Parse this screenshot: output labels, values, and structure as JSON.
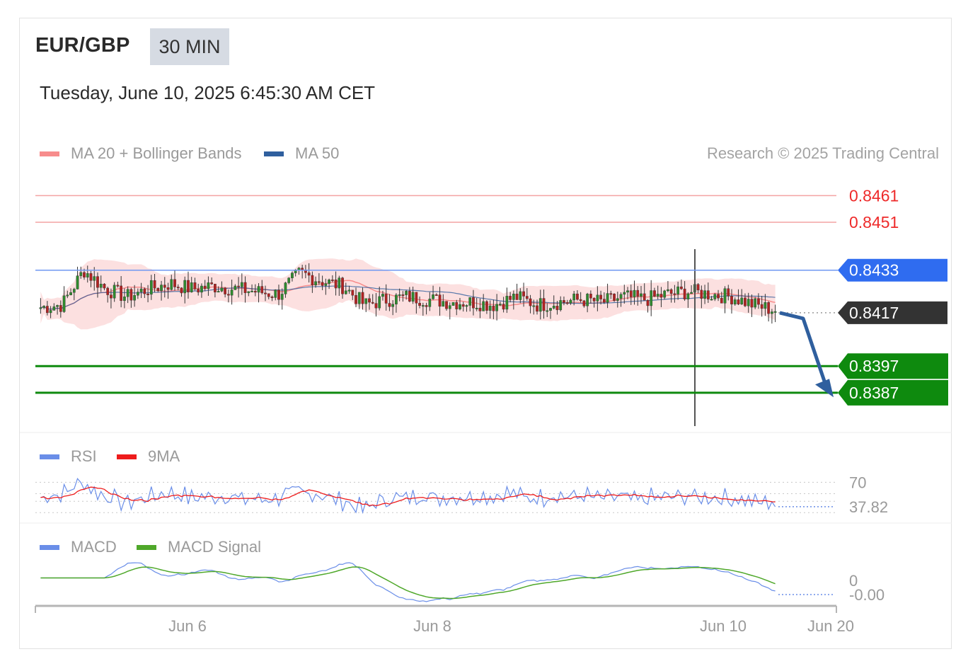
{
  "header": {
    "pair": "EUR/GBP",
    "timeframe": "30 MIN",
    "datetime": "Tuesday, June 10, 2025 6:45:30 AM CET"
  },
  "legend_main": {
    "ma20": "MA 20 + Bollinger Bands",
    "ma50": "MA 50",
    "ma20_color": "#f78c8c",
    "ma50_color": "#2f5f9e"
  },
  "credit": "Research © 2025 Trading Central",
  "legend_rsi": {
    "rsi": "RSI",
    "ma": "9MA",
    "rsi_color": "#6a8ee8",
    "ma_color": "#ee1c1c"
  },
  "legend_macd": {
    "macd": "MACD",
    "signal": "MACD Signal",
    "macd_color": "#6a8ee8",
    "signal_color": "#4fa82a"
  },
  "levels": [
    {
      "value": "0.8461",
      "kind": "resistance",
      "color": "#ee2a2a"
    },
    {
      "value": "0.8451",
      "kind": "resistance",
      "color": "#ee2a2a"
    },
    {
      "value": "0.8433",
      "kind": "pivot",
      "color": "#2f6cf0"
    },
    {
      "value": "0.8417",
      "kind": "last",
      "color": "#333333"
    },
    {
      "value": "0.8397",
      "kind": "support",
      "color": "#0e8a0e"
    },
    {
      "value": "0.8387",
      "kind": "support",
      "color": "#0e8a0e"
    }
  ],
  "rsi": {
    "level_label": "70",
    "last_value": "37.82"
  },
  "macd": {
    "last_value": "-0.00",
    "zero_label": "0"
  },
  "x_axis": {
    "ticks": [
      "Jun 6",
      "Jun 8",
      "Jun 10",
      "Jun 20"
    ]
  },
  "chart_data": {
    "type": "candlestick",
    "title": "EUR/GBP",
    "timeframe": "30 MIN",
    "series_count": 220,
    "price_ylim": [
      0.8375,
      0.8468
    ],
    "key_levels": [
      0.8461,
      0.8451,
      0.8433,
      0.8417,
      0.8397,
      0.8387
    ],
    "last_price": 0.8417,
    "forecast": "down toward 0.8397 / 0.8387",
    "close_path": [
      0.8419,
      0.842,
      0.8433,
      0.8426,
      0.8423,
      0.8426,
      0.8428,
      0.8426,
      0.8427,
      0.8426,
      0.8425,
      0.8424,
      0.8432,
      0.8429,
      0.8427,
      0.842,
      0.8422,
      0.8423,
      0.8422,
      0.8421,
      0.8421,
      0.842,
      0.8423,
      0.842,
      0.8421,
      0.8422,
      0.8421,
      0.8423,
      0.8422,
      0.8424,
      0.8425,
      0.8424,
      0.8423,
      0.842,
      0.8418
    ],
    "rsi": {
      "overbought": 70,
      "last": 37.82
    },
    "macd": {
      "last": -0.0
    }
  }
}
